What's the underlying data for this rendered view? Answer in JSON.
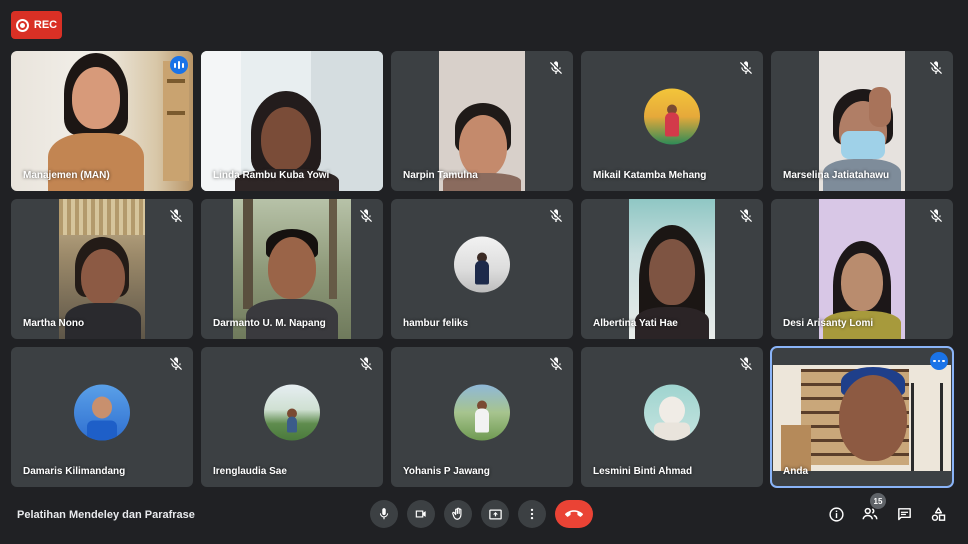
{
  "recording": {
    "label": "REC"
  },
  "meeting": {
    "title": "Pelatihan Mendeley dan Parafrase"
  },
  "participant_count": "15",
  "participants": [
    {
      "name": "Manajemen (MAN)",
      "state": "speaking"
    },
    {
      "name": "Linda Rambu Kuba Yowi",
      "state": "unmuted"
    },
    {
      "name": "Narpin Tamulna",
      "state": "muted"
    },
    {
      "name": "Mikail Katamba Mehang",
      "state": "muted"
    },
    {
      "name": "Marselina Jatiatahawu",
      "state": "muted"
    },
    {
      "name": "Martha Nono",
      "state": "muted"
    },
    {
      "name": "Darmanto U. M. Napang",
      "state": "muted"
    },
    {
      "name": "hambur feliks",
      "state": "muted"
    },
    {
      "name": "Albertina Yati Hae",
      "state": "muted"
    },
    {
      "name": "Desi Arisanty Lomi",
      "state": "muted"
    },
    {
      "name": "Damaris Kilimandang",
      "state": "muted"
    },
    {
      "name": "Irenglaudia Sae",
      "state": "muted"
    },
    {
      "name": "Yohanis P Jawang",
      "state": "muted"
    },
    {
      "name": "Lesmini Binti Ahmad",
      "state": "muted"
    },
    {
      "name": "Anda",
      "state": "self"
    }
  ],
  "controls": {
    "left": [
      "mic-icon",
      "camera-icon",
      "raise-hand-icon",
      "present-icon",
      "more-options-icon",
      "hang-up-icon"
    ],
    "right": [
      "info-icon",
      "people-icon",
      "chat-icon",
      "activities-icon"
    ]
  },
  "colors": {
    "background": "#202124",
    "tile": "#3c4043",
    "rec": "#d93025",
    "hangup": "#ea4335",
    "accent": "#1a73e8"
  }
}
